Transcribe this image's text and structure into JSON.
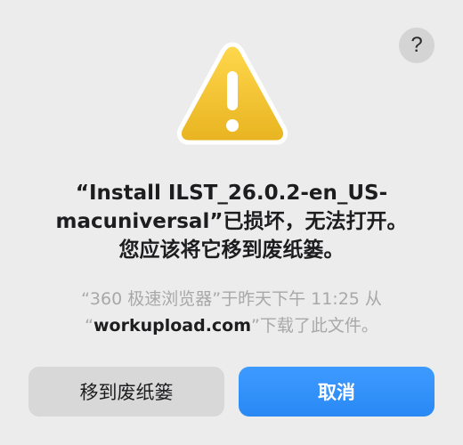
{
  "help": {
    "label": "?"
  },
  "message": {
    "title_line1": "“Install ILST_26.0.2-en_US-",
    "title_line2": "macuniversal”已损坏，无法打开。",
    "title_line3": "您应该将它移到废纸篓。"
  },
  "source": {
    "line1": "“360 极速浏览器”于昨天下午 11:25 从",
    "domain_open": "“",
    "domain": "workupload.com",
    "domain_close": "”下载了此文件。"
  },
  "buttons": {
    "move_to_trash": "移到废纸篓",
    "cancel": "取消"
  },
  "icons": {
    "warning": "warning-triangle-icon",
    "help": "question-mark-icon"
  },
  "colors": {
    "accent": "#2a88f5",
    "warning_yellow": "#f5c53a",
    "background": "#ececec"
  }
}
